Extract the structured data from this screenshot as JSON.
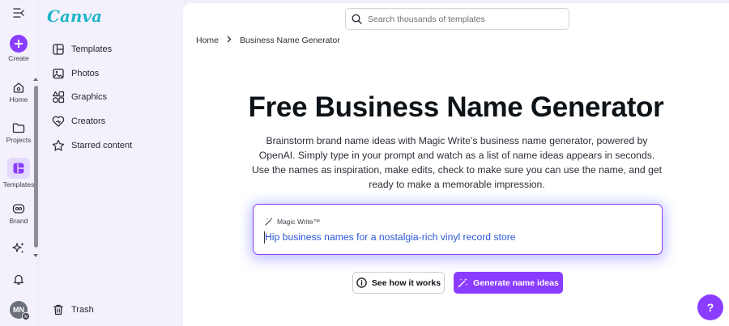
{
  "brand": {
    "logo_text": "Canva",
    "accent": "#8b3dff",
    "logo_color": "#1fb5c7"
  },
  "rail": {
    "menu_icon": "menu-collapse-icon",
    "items": [
      {
        "label": "Create",
        "icon": "plus-icon"
      },
      {
        "label": "Home",
        "icon": "home-icon"
      },
      {
        "label": "Projects",
        "icon": "folder-icon"
      },
      {
        "label": "Templates",
        "icon": "templates-icon",
        "active": true
      },
      {
        "label": "Brand",
        "icon": "brand-icon"
      },
      {
        "label": "",
        "icon": "sparkles-icon"
      }
    ],
    "notifications_icon": "bell-icon",
    "avatar": {
      "initials": "MN",
      "badge": "N"
    }
  },
  "panel": {
    "items": [
      {
        "label": "Templates",
        "icon": "template-doc-icon"
      },
      {
        "label": "Photos",
        "icon": "photo-icon"
      },
      {
        "label": "Graphics",
        "icon": "shapes-icon"
      },
      {
        "label": "Creators",
        "icon": "heart-icon"
      },
      {
        "label": "Starred content",
        "icon": "star-icon"
      }
    ],
    "trash": {
      "label": "Trash",
      "icon": "trash-icon"
    }
  },
  "search": {
    "placeholder": "Search thousands of templates",
    "value": ""
  },
  "breadcrumb": {
    "home": "Home",
    "separator": ">",
    "current": "Business Name Generator"
  },
  "page": {
    "title": "Free Business Name Generator",
    "description": "Brainstorm brand name ideas with Magic Write’s business name generator, powered by OpenAI. Simply type in your prompt and watch as a list of name ideas appears in seconds. Use the names as inspiration, make edits, check to make sure you can use the name, and get ready to make a memorable impression."
  },
  "magic_write": {
    "label": "Magic Write™",
    "input_value": "Hip business names for a nostalgia-rich vinyl record store"
  },
  "buttons": {
    "how": "See how it works",
    "generate": "Generate name ideas"
  },
  "help": {
    "label": "?"
  }
}
